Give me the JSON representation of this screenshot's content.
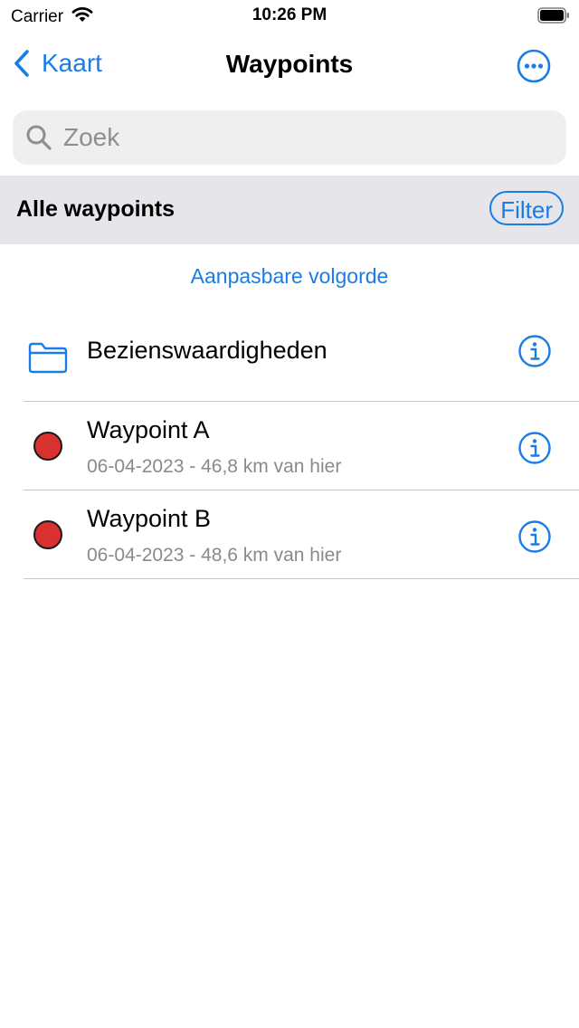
{
  "status": {
    "carrier": "Carrier",
    "time": "10:26 PM"
  },
  "nav": {
    "back_label": "Kaart",
    "title": "Waypoints"
  },
  "search": {
    "placeholder": "Zoek",
    "value": ""
  },
  "section": {
    "title": "Alle waypoints",
    "filter_label": "Filter"
  },
  "sort_label": "Aanpasbare volgorde",
  "folders": [
    {
      "name": "Bezienswaardigheden",
      "icon": "folder-icon"
    }
  ],
  "waypoints": [
    {
      "name": "Waypoint A",
      "detail": "06-04-2023 - 46,8 km van hier",
      "color": "#d93030"
    },
    {
      "name": "Waypoint B",
      "detail": "06-04-2023 - 48,6 km van hier",
      "color": "#d93030"
    }
  ],
  "colors": {
    "accent": "#1a7ce6",
    "waypoint_marker": "#d93030",
    "section_bg": "#e5e5ea",
    "search_bg": "#efeff0"
  }
}
